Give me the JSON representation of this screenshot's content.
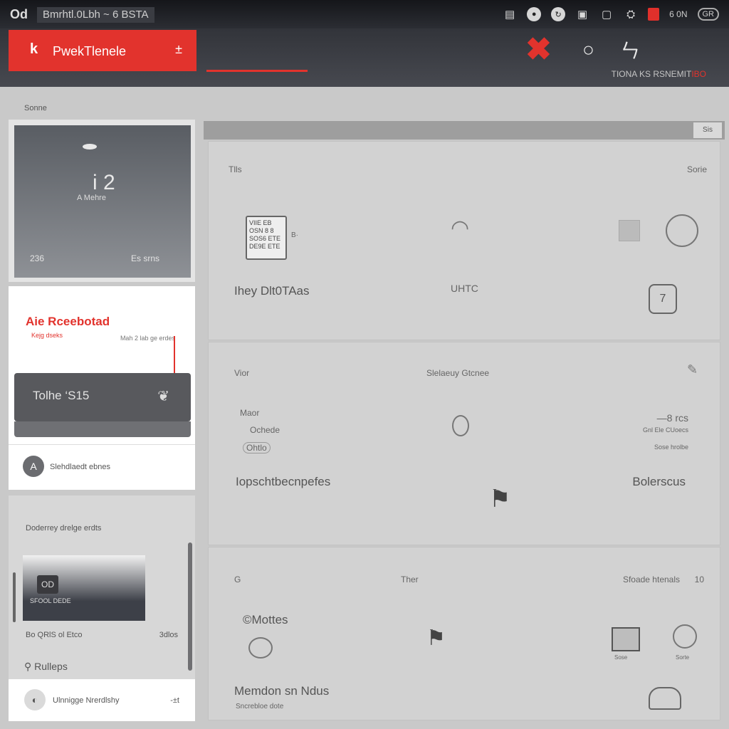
{
  "window": {
    "title": "Bmrhtl.0Lbh  ~  6 BSTA",
    "logo": "Od",
    "tray": {
      "text": "6  0N",
      "pill": "GR"
    }
  },
  "header": {
    "tab_label": "PwekTlenele",
    "tab_icon": "k",
    "tab_menu": "±",
    "status_text": "TIONA KS RSNEMIT",
    "status_accent": "IBO",
    "accent_color": "#e2332d"
  },
  "breadcrumb": "Sonne",
  "hero": {
    "number": "i 2",
    "subtitle": "A Mehre",
    "foot_left": "236",
    "foot_right": "Es srns"
  },
  "alert": {
    "title": "Aie Rceebotad",
    "subtitle": "Kejg dseks",
    "meta": "Mah 2 lab ge erdes",
    "button_label": "Tolhe ‘S15",
    "avatar": "A",
    "avatar_label": "Slehdlaedt ebnes"
  },
  "list": {
    "title": "Doderrey drelge erdts",
    "thumb_tag": "OD",
    "thumb_caption": "SFOOL DEDE",
    "meta_left": "Bo QRlS ol Etco",
    "meta_right": "3dlos",
    "help": "Rulleps",
    "foot_label": "Ulnnigge Nrerdlshy",
    "foot_right": "-±t"
  },
  "main_head_button": "Sis",
  "panel1": {
    "top_left": "Tlls",
    "top_right": "Sorie",
    "boxed_lines": [
      "VIIE EB",
      "OSN 8 8",
      "SOS6 ETE",
      "DE9E ETE"
    ],
    "boxed_side": "B·",
    "row_label": "Ihey Dlt0TAas",
    "center_label": "UHTC",
    "square_icon": "7"
  },
  "panel2": {
    "left_label": "Vior",
    "center_label": "Slelaeuy Gtcnee",
    "small_1": "Maor",
    "small_2": "Ochede",
    "small_3": "Ohtlo",
    "right_num": "—8 rcs",
    "right_small_1": "Gnl Ele CUoecs",
    "right_small_2": "Sose hrolbe",
    "big_left": "Iopschtbecnpefes",
    "big_right": "Bolerscus"
  },
  "panel3": {
    "left_label": "G",
    "center_label": "Ther",
    "right_label": "Sfoade htenals",
    "right_num": "10",
    "brand": "©Mottes",
    "big_left": "Memdon sn Ndus",
    "small_left": "Sncrebloe dote",
    "icon_cap_1": "Sose",
    "icon_cap_2": "Sorte"
  }
}
